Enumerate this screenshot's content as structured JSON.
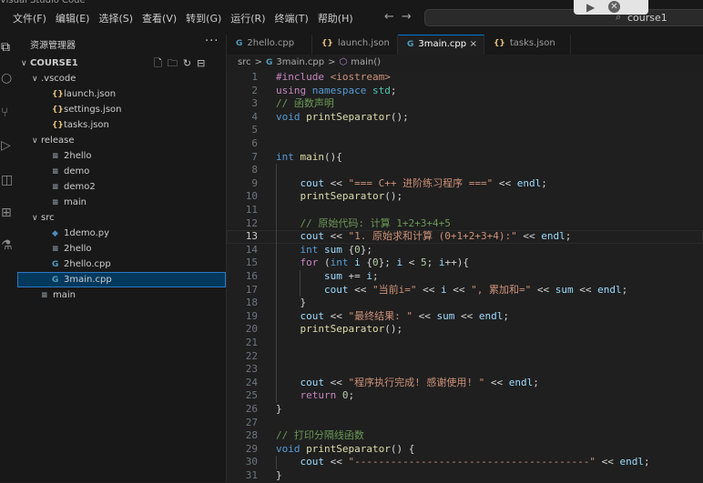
{
  "top_partial_text": "Visual Studio Code",
  "menu": [
    "文件(F)",
    "编辑(E)",
    "选择(S)",
    "查看(V)",
    "转到(G)",
    "运行(R)",
    "终端(T)",
    "帮助(H)"
  ],
  "search": {
    "text": "course1"
  },
  "sidebar": {
    "title": "资源管理器",
    "more": "···",
    "tree": [
      {
        "label": "COURSE1",
        "indent": 0,
        "arrow": "∨",
        "icon": "",
        "bold": true
      },
      {
        "label": ".vscode",
        "indent": 1,
        "arrow": "∨",
        "icon": ""
      },
      {
        "label": "launch.json",
        "indent": 2,
        "arrow": "",
        "icon": "{}",
        "type": "json"
      },
      {
        "label": "settings.json",
        "indent": 2,
        "arrow": "",
        "icon": "{}",
        "type": "json"
      },
      {
        "label": "tasks.json",
        "indent": 2,
        "arrow": "",
        "icon": "{}",
        "type": "json"
      },
      {
        "label": "release",
        "indent": 1,
        "arrow": "∨",
        "icon": ""
      },
      {
        "label": "2hello",
        "indent": 2,
        "arrow": "",
        "icon": "≡",
        "type": "file"
      },
      {
        "label": "demo",
        "indent": 2,
        "arrow": "",
        "icon": "≡",
        "type": "file"
      },
      {
        "label": "demo2",
        "indent": 2,
        "arrow": "",
        "icon": "≡",
        "type": "file"
      },
      {
        "label": "main",
        "indent": 2,
        "arrow": "",
        "icon": "≡",
        "type": "file"
      },
      {
        "label": "src",
        "indent": 1,
        "arrow": "∨",
        "icon": ""
      },
      {
        "label": "1demo.py",
        "indent": 2,
        "arrow": "",
        "icon": "◆",
        "type": "py"
      },
      {
        "label": "2hello",
        "indent": 2,
        "arrow": "",
        "icon": "≡",
        "type": "file"
      },
      {
        "label": "2hello.cpp",
        "indent": 2,
        "arrow": "",
        "icon": "G",
        "type": "cpp"
      },
      {
        "label": "3main.cpp",
        "indent": 2,
        "arrow": "",
        "icon": "G",
        "type": "cpp",
        "selected": true
      },
      {
        "label": "main",
        "indent": 1,
        "arrow": "",
        "icon": "≡",
        "type": "file"
      }
    ]
  },
  "tabs": [
    {
      "label": "2hello.cpp",
      "icon": "G",
      "type": "cpp"
    },
    {
      "label": "launch.json",
      "icon": "{}",
      "type": "json"
    },
    {
      "label": "3main.cpp",
      "icon": "G",
      "type": "cpp",
      "active": true,
      "close": "×"
    },
    {
      "label": "tasks.json",
      "icon": "{}",
      "type": "json"
    }
  ],
  "breadcrumb": [
    "src",
    ">",
    "3main.cpp",
    ">",
    "main()"
  ],
  "editor": {
    "current_line": 13,
    "lines": [
      [
        [
          "#include ",
          "kc"
        ],
        [
          "<iostream>",
          "s"
        ]
      ],
      [
        [
          "using ",
          "kc"
        ],
        [
          "namespace ",
          "k"
        ],
        [
          "std",
          "ns"
        ],
        [
          ";",
          ""
        ]
      ],
      [
        [
          "// 函数声明",
          "c"
        ]
      ],
      [
        [
          "void ",
          "k"
        ],
        [
          "printSeparator",
          "f"
        ],
        [
          "();",
          ""
        ]
      ],
      [],
      [],
      [
        [
          "int ",
          "k"
        ],
        [
          "main",
          "f"
        ],
        [
          "(){",
          ""
        ]
      ],
      [],
      [
        [
          "    ",
          ""
        ],
        [
          "cout",
          "v"
        ],
        [
          " << ",
          ""
        ],
        [
          "\"=== C++ 进阶练习程序 ===\"",
          "s"
        ],
        [
          " << ",
          ""
        ],
        [
          "endl",
          "v"
        ],
        [
          ";",
          ""
        ]
      ],
      [
        [
          "    ",
          ""
        ],
        [
          "printSeparator",
          "f"
        ],
        [
          "();",
          ""
        ]
      ],
      [],
      [
        [
          "    ",
          ""
        ],
        [
          "// 原始代码: 计算 1+2+3+4+5",
          "c"
        ]
      ],
      [
        [
          "    ",
          ""
        ],
        [
          "cout",
          "v"
        ],
        [
          " << ",
          ""
        ],
        [
          "\"1. 原始求和计算 (0+1+2+3+4):\"",
          "s"
        ],
        [
          " << ",
          ""
        ],
        [
          "endl",
          "v"
        ],
        [
          ";",
          ""
        ]
      ],
      [
        [
          "    ",
          ""
        ],
        [
          "int ",
          "k"
        ],
        [
          "sum",
          "v"
        ],
        [
          " {",
          ""
        ],
        [
          "0",
          "n"
        ],
        [
          "};",
          ""
        ]
      ],
      [
        [
          "    ",
          ""
        ],
        [
          "for ",
          "kc"
        ],
        [
          "(",
          ""
        ],
        [
          "int ",
          "k"
        ],
        [
          "i",
          "v"
        ],
        [
          " {",
          ""
        ],
        [
          "0",
          "n"
        ],
        [
          "}; ",
          ""
        ],
        [
          "i",
          "v"
        ],
        [
          " < ",
          ""
        ],
        [
          "5",
          "n"
        ],
        [
          "; ",
          ""
        ],
        [
          "i",
          "v"
        ],
        [
          "++){",
          ""
        ]
      ],
      [
        [
          "        ",
          ""
        ],
        [
          "sum",
          "v"
        ],
        [
          " += ",
          ""
        ],
        [
          "i",
          "v"
        ],
        [
          ";",
          ""
        ]
      ],
      [
        [
          "        ",
          ""
        ],
        [
          "cout",
          "v"
        ],
        [
          " << ",
          ""
        ],
        [
          "\"当前i=\"",
          "s"
        ],
        [
          " << ",
          ""
        ],
        [
          "i",
          "v"
        ],
        [
          " << ",
          ""
        ],
        [
          "\", 累加和=\"",
          "s"
        ],
        [
          " << ",
          ""
        ],
        [
          "sum",
          "v"
        ],
        [
          " << ",
          ""
        ],
        [
          "endl",
          "v"
        ],
        [
          ";",
          ""
        ]
      ],
      [
        [
          "    }",
          ""
        ]
      ],
      [
        [
          "    ",
          ""
        ],
        [
          "cout",
          "v"
        ],
        [
          " << ",
          ""
        ],
        [
          "\"最终结果: \"",
          "s"
        ],
        [
          " << ",
          ""
        ],
        [
          "sum",
          "v"
        ],
        [
          " << ",
          ""
        ],
        [
          "endl",
          "v"
        ],
        [
          ";",
          ""
        ]
      ],
      [
        [
          "    ",
          ""
        ],
        [
          "printSeparator",
          "f"
        ],
        [
          "();",
          ""
        ]
      ],
      [],
      [],
      [],
      [
        [
          "    ",
          ""
        ],
        [
          "cout",
          "v"
        ],
        [
          " << ",
          ""
        ],
        [
          "\"程序执行完成! 感谢使用! \"",
          "s"
        ],
        [
          " << ",
          ""
        ],
        [
          "endl",
          "v"
        ],
        [
          ";",
          ""
        ]
      ],
      [
        [
          "    ",
          ""
        ],
        [
          "return ",
          "kc"
        ],
        [
          "0",
          "n"
        ],
        [
          ";",
          ""
        ]
      ],
      [
        [
          "}",
          ""
        ]
      ],
      [],
      [
        [
          "// 打印分隔线函数",
          "c"
        ]
      ],
      [
        [
          "void ",
          "k"
        ],
        [
          "printSeparator",
          "f"
        ],
        [
          "() {",
          ""
        ]
      ],
      [
        [
          "    ",
          ""
        ],
        [
          "cout",
          "v"
        ],
        [
          " << ",
          ""
        ],
        [
          "\"---------------------------------------\"",
          "s"
        ],
        [
          " << ",
          ""
        ],
        [
          "endl",
          "v"
        ],
        [
          ";",
          ""
        ]
      ],
      [
        [
          "}",
          ""
        ]
      ]
    ]
  }
}
